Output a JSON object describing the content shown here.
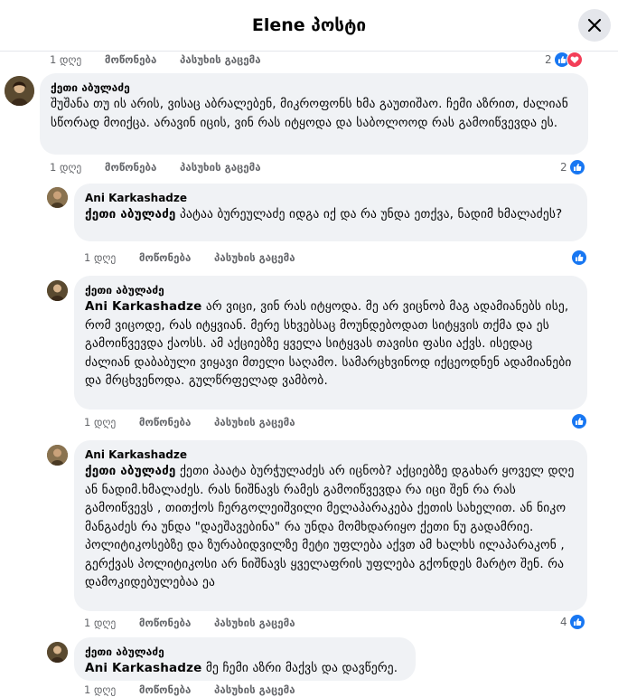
{
  "header": {
    "title": "Elene პოსტი"
  },
  "actions": {
    "like": "მოწონება",
    "reply": "პასუხის გაცემა"
  },
  "top_row": {
    "time": "1 დღე",
    "count": "2"
  },
  "comments": [
    {
      "author": "ქეთი აბულაძე",
      "mention": "",
      "text": "შუშანა თუ ის არის, ვისაც აბრალებენ, მიკროფონს ხმა გაუთიშაო. ჩემი აზრით, ძალიან სწორად მოიქცა. არავინ იცის, ვინ რას იტყოდა და საბოლოოდ რას გამოიწვევდა ეს.",
      "time": "1 დღე",
      "reactions": "2"
    },
    {
      "author": "Ani Karkashadze",
      "mention": "ქეთი აბულაძე",
      "text": " პატაა ბურეულაძე იდგა იქ და რა უნდა ეთქვა, ნადიმ ხმალაძეს?",
      "time": "1 დღე",
      "reactions": ""
    },
    {
      "author": "ქეთი აბულაძე",
      "mention": "Ani Karkashadze",
      "text": " არ ვიცი, ვინ რას იტყოდა. მე არ ვიცნობ მაგ ადამიანებს ისე, რომ ვიცოდე, რას იტყვიან. მერე სხვებსაც მოუნდებოდათ სიტყვის თქმა და ეს გამოიწვევდა ქაოსს. ამ აქციებზე ყველა სიტყვას თავისი ფასი აქვს. ისედაც ძალიან დაბაბული ვიყავი მთელი საღამო. სამარცხვინოდ იქცეოდნენ ადამიანები და მრცხვენოდა. გულწრფელად ვამბობ.",
      "time": "1 დღე",
      "reactions": ""
    },
    {
      "author": "Ani Karkashadze",
      "mention": "ქეთი აბულაძე",
      "text": " ქეთი პაატა ბურჭულაძეს არ იცნობ? აქციებზე დგახარ ყოველ დღე ან ნადიმ.ხმალაძეს. რას ნიშნავს რამეს გამოიწვევდა რა იცი შენ რა რას გამოიწვევს , თითქოს ჩერგოლეიშვილი მელაპარაკება ქეთის სახელით. ან ნიკო მანგაძეს რა უნდა \"დაეშავებინა\" რა უნდა მომხდარიყო ქეთი ნუ გადამრიე. პოლიტიკოსებზე და ზურაბიდვილზე მეტი უფლება აქვთ ამ ხალხს ილაპარაკონ , გერქვას პოლიტიკოსი არ ნიშნავს ყველაფრის უფლება გქონდეს მარტო შენ. რა დამოკიდებულებაა ეა",
      "time": "1 დღე",
      "reactions": "4"
    },
    {
      "author": "ქეთი აბულაძე",
      "mention": "Ani Karkashadze",
      "text": " მე ჩემი აზრი მაქვს და დავწერე.",
      "time": "1 დღე",
      "reactions": ""
    }
  ]
}
